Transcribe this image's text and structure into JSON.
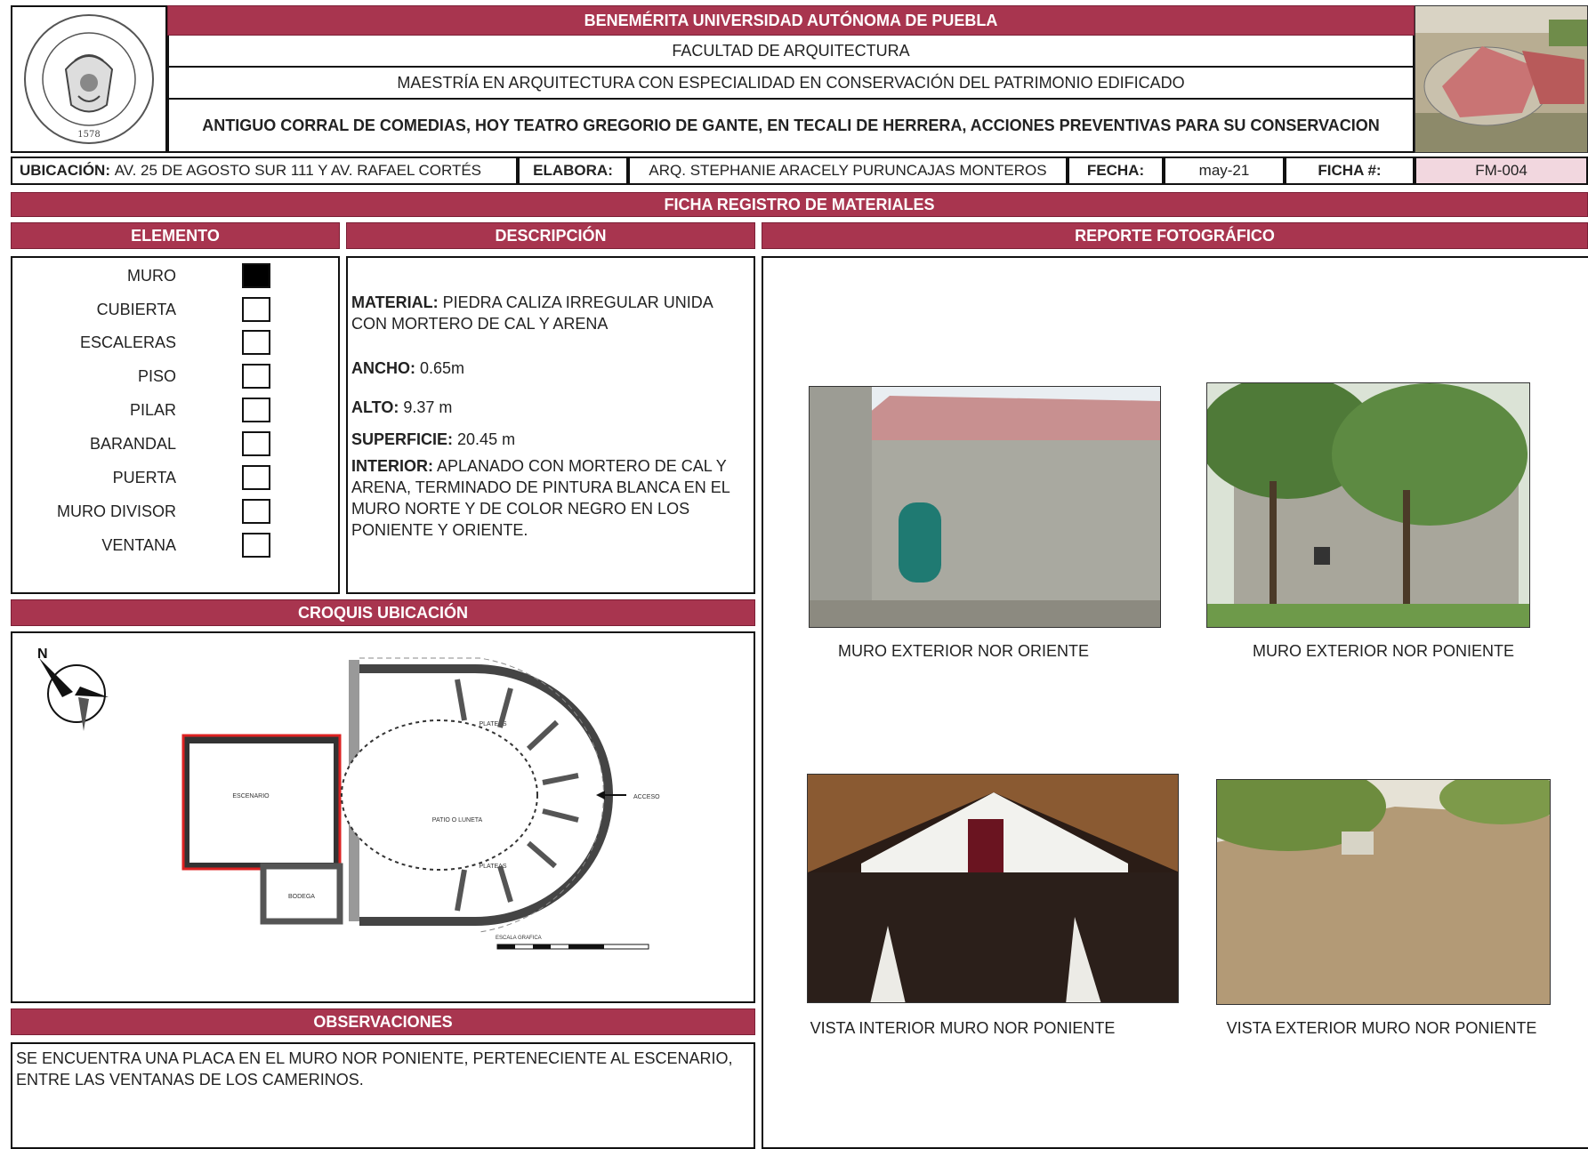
{
  "header": {
    "university": "BENEMÉRITA UNIVERSIDAD AUTÓNOMA DE PUEBLA",
    "faculty": "FACULTAD DE ARQUITECTURA",
    "program": "MAESTRÍA EN  ARQUITECTURA CON ESPECIALIDAD EN CONSERVACIÓN DEL PATRIMONIO EDIFICADO",
    "project_title": "ANTIGUO CORRAL DE COMEDIAS, HOY TEATRO GREGORIO DE GANTE, EN TECALI DE HERRERA, ACCIONES PREVENTIVAS PARA SU CONSERVACION",
    "seal_year": "1578"
  },
  "info": {
    "ubicacion_label": "UBICACIÓN:",
    "ubicacion_value": "AV. 25 DE AGOSTO SUR 111 Y AV. RAFAEL CORTÉS",
    "elabora_label": "ELABORA:",
    "elabora_value": "ARQ. STEPHANIE ARACELY PURUNCAJAS MONTEROS",
    "fecha_label": "FECHA:",
    "fecha_value": "may-21",
    "ficha_label": "FICHA #:",
    "ficha_value": "FM-004"
  },
  "sections": {
    "registro": "FICHA REGISTRO DE MATERIALES",
    "elemento": "ELEMENTO",
    "descripcion": "DESCRIPCIÓN",
    "reporte": "REPORTE FOTOGRÁFICO",
    "croquis": "CROQUIS UBICACIÓN",
    "observaciones": "OBSERVACIONES"
  },
  "elementos": [
    {
      "name": "MURO",
      "checked": true
    },
    {
      "name": "CUBIERTA",
      "checked": false
    },
    {
      "name": "ESCALERAS",
      "checked": false
    },
    {
      "name": "PISO",
      "checked": false
    },
    {
      "name": "PILAR",
      "checked": false
    },
    {
      "name": "BARANDAL",
      "checked": false
    },
    {
      "name": "PUERTA",
      "checked": false
    },
    {
      "name": "MURO DIVISOR",
      "checked": false
    },
    {
      "name": "VENTANA",
      "checked": false
    }
  ],
  "descripcion": {
    "material_label": "MATERIAL:",
    "material_value": "PIEDRA CALIZA IRREGULAR UNIDA CON MORTERO DE CAL Y ARENA",
    "ancho_label": "ANCHO:",
    "ancho_value": "0.65m",
    "alto_label": "ALTO:",
    "alto_value": "9.37 m",
    "superficie_label": "SUPERFICIE:",
    "superficie_value": "20.45 m",
    "interior_label": "INTERIOR:",
    "interior_value": "APLANADO CON MORTERO DE CAL Y ARENA, TERMINADO DE PINTURA BLANCA EN EL MURO NORTE Y DE COLOR NEGRO EN LOS PONIENTE Y ORIENTE."
  },
  "plan": {
    "escenario": "ESCENARIO",
    "patio": "PATIO O LUNETA",
    "plateas_top": "PLATEAS",
    "plateas_bottom": "PLATEAS",
    "bodega": "BODEGA",
    "acceso": "ACCESO",
    "escala": "ESCALA GRAFICA"
  },
  "fotos": [
    {
      "caption": "MURO EXTERIOR NOR ORIENTE"
    },
    {
      "caption": "MURO EXTERIOR NOR PONIENTE"
    },
    {
      "caption": "VISTA INTERIOR MURO NOR PONIENTE"
    },
    {
      "caption": "VISTA EXTERIOR MURO NOR PONIENTE"
    }
  ],
  "observaciones": "SE ENCUENTRA UNA PLACA EN EL MURO NOR PONIENTE, PERTENECIENTE AL ESCENARIO, ENTRE LAS VENTANAS DE LOS CAMERINOS.",
  "colors": {
    "accent": "#a8354f",
    "ficha_bg": "#f2d7df"
  }
}
